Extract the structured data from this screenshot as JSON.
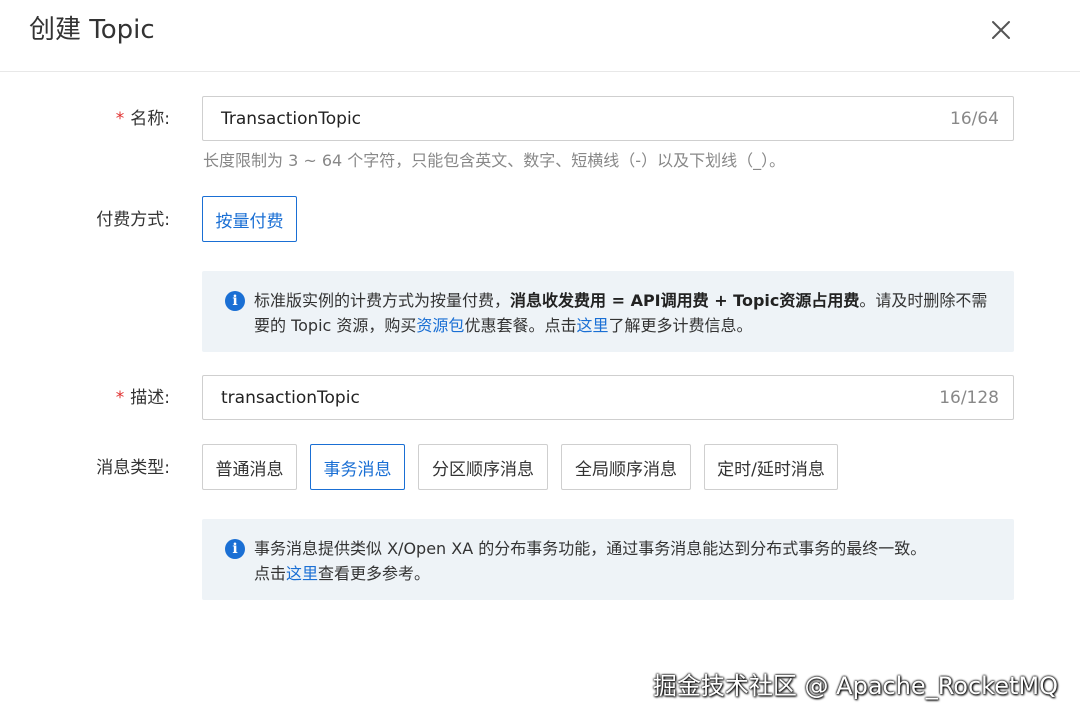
{
  "dialog": {
    "title": "创建 Topic"
  },
  "form": {
    "name": {
      "required_mark": "*",
      "label": "名称:",
      "value": "TransactionTopic",
      "count": "16/64",
      "hint": "长度限制为 3 ~ 64 个字符，只能包含英文、数字、短横线（-）以及下划线（_）。"
    },
    "billing": {
      "label": "付费方式:",
      "option": "按量付费",
      "info": {
        "t1": "标准版实例的计费方式为按量付费，",
        "b1": "消息收发费用 = API调用费 + Topic资源占用费",
        "t2": "。请及时删除不需要的 Topic 资源，购买",
        "link1": "资源包",
        "t3": "优惠套餐。点击",
        "link2": "这里",
        "t4": "了解更多计费信息。"
      }
    },
    "description": {
      "required_mark": "*",
      "label": "描述:",
      "value": "transactionTopic",
      "count": "16/128"
    },
    "message_type": {
      "label": "消息类型:",
      "options": [
        "普通消息",
        "事务消息",
        "分区顺序消息",
        "全局顺序消息",
        "定时/延时消息"
      ],
      "selected": "事务消息",
      "info": {
        "t1": "事务消息提供类似 X/Open XA 的分布事务功能，通过事务消息能达到分布式事务的最终一致。",
        "t2": "点击",
        "link": "这里",
        "t3": "查看更多参考。"
      }
    }
  },
  "watermark": "掘金技术社区 @ Apache_RocketMQ",
  "colors": {
    "accent": "#1a6fd4",
    "required": "#e0302f",
    "info_bg": "#eef3f7"
  }
}
